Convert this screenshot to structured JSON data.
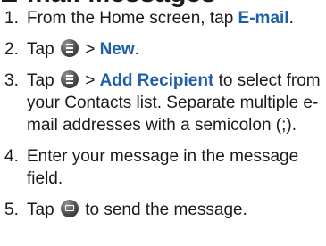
{
  "heading_partial": "E-mail Messages",
  "steps": [
    {
      "number": "1.",
      "text_a": "From the Home screen, tap ",
      "link_a": "E-mail",
      "text_b": "."
    },
    {
      "number": "2.",
      "text_a": "Tap ",
      "icon": "menu-icon",
      "text_b": " > ",
      "link_a": "New",
      "text_c": "."
    },
    {
      "number": "3.",
      "text_a": "Tap ",
      "icon": "menu-icon",
      "text_b": " > ",
      "link_a": "Add Recipient",
      "text_c": " to select from your Contacts list. Separate multiple e-mail addresses with a semicolon (;)."
    },
    {
      "number": "4.",
      "text_a": "Enter your message in the message field."
    },
    {
      "number": "5.",
      "text_a": "Tap ",
      "icon": "send-icon",
      "text_b": " to send the message."
    }
  ]
}
